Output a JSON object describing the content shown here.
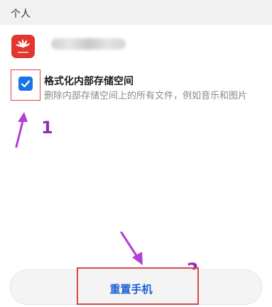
{
  "section": {
    "title": "个人"
  },
  "account": {
    "logo_icon": "huawei-logo",
    "name": ""
  },
  "format_option": {
    "checked": true,
    "title": "格式化内部存储空间",
    "description": "删除内部存储空间上的所有文件，例如音乐和图片"
  },
  "annotations": {
    "step1": "1",
    "step2": "2",
    "highlight_color": "#d74848",
    "arrow_color": "#b23fd6"
  },
  "reset_button": {
    "label": "重置手机"
  },
  "colors": {
    "accent": "#1a73e8",
    "button_text": "#1a5fd6",
    "logo": "#e1372e"
  }
}
